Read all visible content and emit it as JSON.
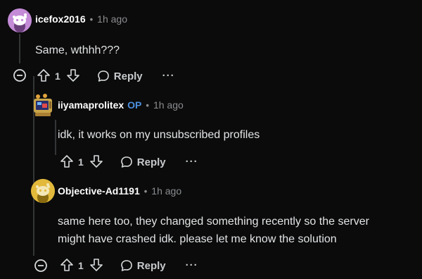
{
  "comments": [
    {
      "author": "icefox2016",
      "op_badge": "",
      "separator": "•",
      "time": "1h ago",
      "text": "Same, wthhh???",
      "votes": "1",
      "reply_label": "Reply",
      "more_label": "···",
      "avatar_color": "#c48bd7"
    },
    {
      "author": "iiyamaprolitex",
      "op_badge": "OP",
      "separator": "•",
      "time": "1h ago",
      "text": "idk, it works on my unsubscribed profiles",
      "votes": "1",
      "reply_label": "Reply",
      "more_label": "···"
    },
    {
      "author": "Objective-Ad1191",
      "op_badge": "",
      "separator": "•",
      "time": "1h ago",
      "text_line1": "same here too, they changed something recently so the server",
      "text_line2": "might have crashed idk. please let me know the solution",
      "votes": "1",
      "reply_label": "Reply",
      "more_label": "···",
      "avatar_color": "#e2b93b"
    }
  ],
  "colors": {
    "background": "#0b0b0b",
    "op_blue": "#4b8fe0",
    "meta_gray": "#8a8c8f",
    "thread_line": "#343536"
  },
  "icons": [
    "upvote-icon",
    "downvote-icon",
    "reply-icon",
    "collapse-icon"
  ]
}
